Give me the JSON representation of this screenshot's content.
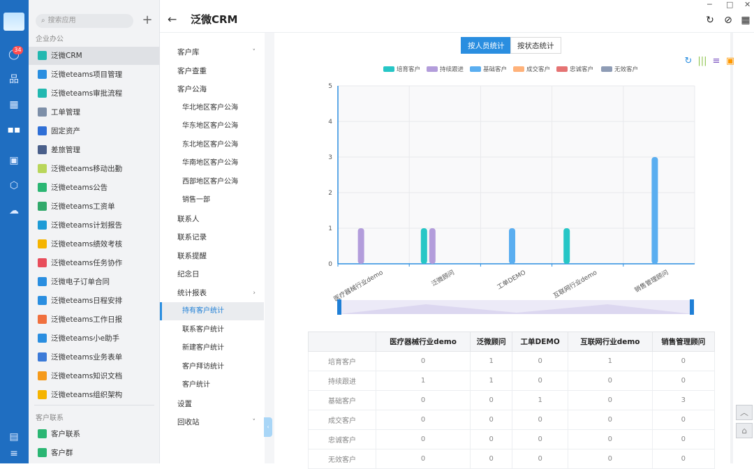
{
  "app": {
    "title": "泛微CRM",
    "search_placeholder": "搜索应用",
    "badge_count": "34"
  },
  "apps_sidebar": {
    "group1": "企业办公",
    "items": [
      {
        "label": "泛微CRM",
        "color": "#22b8b0"
      },
      {
        "label": "泛微eteams项目管理",
        "color": "#2a8ee0"
      },
      {
        "label": "泛微eteams审批流程",
        "color": "#22b8b0"
      },
      {
        "label": "工单管理",
        "color": "#7d8fa8"
      },
      {
        "label": "固定资产",
        "color": "#2f6fd6"
      },
      {
        "label": "差旅管理",
        "color": "#4a5f8a"
      },
      {
        "label": "泛微eteams移动出勤",
        "color": "#b9d65a"
      },
      {
        "label": "泛微eteams公告",
        "color": "#2bb673"
      },
      {
        "label": "泛微eteams工资单",
        "color": "#31a96b"
      },
      {
        "label": "泛微eteams计划报告",
        "color": "#1e9bd6"
      },
      {
        "label": "泛微eteams绩效考核",
        "color": "#f5b400"
      },
      {
        "label": "泛微eteams任务协作",
        "color": "#e84d5b"
      },
      {
        "label": "泛微电子订单合同",
        "color": "#2a8ee0"
      },
      {
        "label": "泛微eteams日程安排",
        "color": "#2a8ee0"
      },
      {
        "label": "泛微eteams工作日报",
        "color": "#f0703e"
      },
      {
        "label": "泛微eteams小e助手",
        "color": "#2a8ee0"
      },
      {
        "label": "泛微eteams业务表单",
        "color": "#3b7ad8"
      },
      {
        "label": "泛微eteams知识文档",
        "color": "#f59a1b"
      },
      {
        "label": "泛微eteams组织架构",
        "color": "#f5b400"
      }
    ],
    "group2": "客户联系",
    "items2": [
      {
        "label": "客户联系",
        "color": "#2bb673"
      },
      {
        "label": "客户群",
        "color": "#2bb673"
      }
    ]
  },
  "crm_menu": {
    "items": [
      {
        "label": "客户库",
        "type": "main",
        "chev": "˅"
      },
      {
        "label": "客户查重",
        "type": "main"
      },
      {
        "label": "客户公海",
        "type": "main"
      },
      {
        "label": "华北地区客户公海",
        "type": "sub"
      },
      {
        "label": "华东地区客户公海",
        "type": "sub"
      },
      {
        "label": "东北地区客户公海",
        "type": "sub"
      },
      {
        "label": "华南地区客户公海",
        "type": "sub"
      },
      {
        "label": "西部地区客户公海",
        "type": "sub"
      },
      {
        "label": "销售一部",
        "type": "sub"
      },
      {
        "label": "联系人",
        "type": "main"
      },
      {
        "label": "联系记录",
        "type": "main"
      },
      {
        "label": "联系提醒",
        "type": "main"
      },
      {
        "label": "纪念日",
        "type": "main"
      },
      {
        "label": "统计报表",
        "type": "main",
        "chev": "›"
      },
      {
        "label": "持有客户统计",
        "type": "sub",
        "selected": true
      },
      {
        "label": "联系客户统计",
        "type": "sub"
      },
      {
        "label": "新建客户统计",
        "type": "sub"
      },
      {
        "label": "客户拜访统计",
        "type": "sub"
      },
      {
        "label": "客户统计",
        "type": "sub"
      },
      {
        "label": "设置",
        "type": "main"
      },
      {
        "label": "回收站",
        "type": "main",
        "chev": "˅"
      }
    ]
  },
  "tabs": {
    "by_person": "按人员统计",
    "by_status": "按状态统计"
  },
  "chart_data": {
    "type": "bar",
    "categories": [
      "医疗器械行业demo",
      "泛微顾问",
      "工单DEMO",
      "互联网行业demo",
      "销售管理顾问"
    ],
    "series": [
      {
        "name": "培育客户",
        "color": "#26c6c6",
        "values": [
          0,
          1,
          0,
          1,
          0
        ]
      },
      {
        "name": "持续跟进",
        "color": "#b39ddb",
        "values": [
          1,
          1,
          0,
          0,
          0
        ]
      },
      {
        "name": "基础客户",
        "color": "#5aaef0",
        "values": [
          0,
          0,
          1,
          0,
          3
        ]
      },
      {
        "name": "成交客户",
        "color": "#ffb27a",
        "values": [
          0,
          0,
          0,
          0,
          0
        ]
      },
      {
        "name": "忠诚客户",
        "color": "#e57373",
        "values": [
          0,
          0,
          0,
          0,
          0
        ]
      },
      {
        "name": "无效客户",
        "color": "#8e9cb5",
        "values": [
          0,
          0,
          0,
          0,
          0
        ]
      }
    ],
    "yticks": [
      "0",
      "1",
      "2",
      "3",
      "4",
      "5"
    ],
    "ylim": [
      0,
      5
    ],
    "legend": "top",
    "grid": true
  },
  "table": {
    "headers": [
      "",
      "医疗器械行业demo",
      "泛微顾问",
      "工单DEMO",
      "互联网行业demo",
      "销售管理顾问"
    ],
    "rows": [
      [
        "培育客户",
        "0",
        "1",
        "0",
        "1",
        "0"
      ],
      [
        "持续跟进",
        "1",
        "1",
        "0",
        "0",
        "0"
      ],
      [
        "基础客户",
        "0",
        "0",
        "1",
        "0",
        "3"
      ],
      [
        "成交客户",
        "0",
        "0",
        "0",
        "0",
        "0"
      ],
      [
        "忠诚客户",
        "0",
        "0",
        "0",
        "0",
        "0"
      ],
      [
        "无效客户",
        "0",
        "0",
        "0",
        "0",
        "0"
      ]
    ]
  }
}
